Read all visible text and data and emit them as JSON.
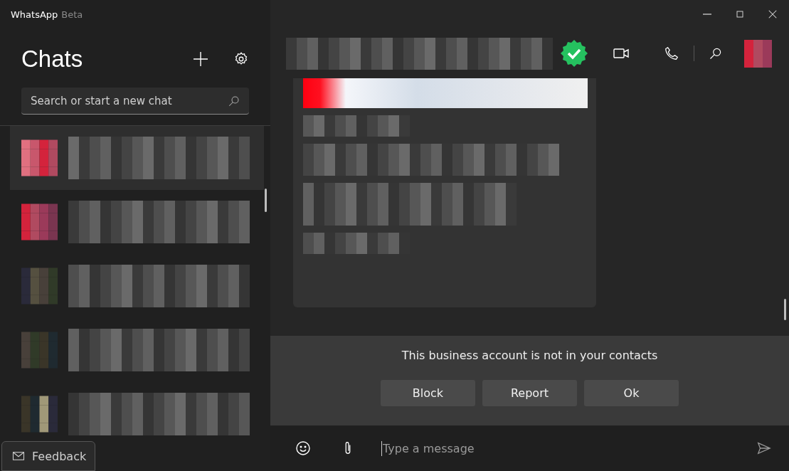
{
  "window": {
    "title": "WhatsApp",
    "badge": "Beta"
  },
  "sidebar": {
    "heading": "Chats",
    "search": {
      "placeholder": "Search or start a new chat"
    },
    "chats": [
      {
        "selected": true
      },
      {
        "selected": false
      },
      {
        "selected": false
      },
      {
        "selected": false
      },
      {
        "selected": false
      }
    ]
  },
  "feedback": {
    "label": "Feedback"
  },
  "conversation": {
    "verified": true,
    "notice": {
      "text": "This business account is not in your contacts",
      "buttons": [
        "Block",
        "Report",
        "Ok"
      ]
    },
    "composer": {
      "placeholder": "Type a message"
    }
  }
}
